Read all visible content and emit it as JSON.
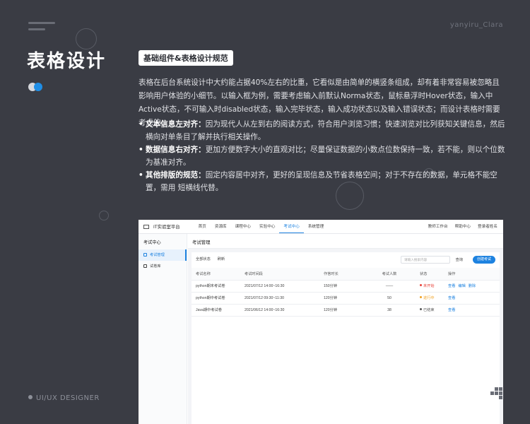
{
  "watermark": "yanyiru_Clara",
  "title": "表格设计",
  "tag": "基础组件&表格设计规范",
  "paragraph": "表格在后台系统设计中大约能占据40%左右的比重，它看似是由简单的横竖条组成，却有着非常容易被忽略且影响用户体验的小细节。以输入框为例，需要考虑输入前默认Norma状态，鼠标悬浮时Hover状态，输入中Active状态，不可输入时disabled状态，输入完毕状态，输入成功状态以及输入错误状态；而设计表格时需要考虑的：",
  "bullets": [
    {
      "title": "文本信息左对齐：",
      "text": "因为现代人从左到右的阅读方式，符合用户浏览习惯；快速浏览对比列获知关键信息，然后横向对单条目了解并执行相关操作。"
    },
    {
      "title": "数据信息右对齐：",
      "text": "更加方便数字大小的直观对比；尽量保证数据的小数点位数保持一致，若不能，则以个位数为基准对齐。"
    },
    {
      "title": "其他排版的规范：",
      "text": "固定内容居中对齐，更好的呈现信息及节省表格空间；对于不存在的数据，单元格不能空置，需用 短横线代替。"
    }
  ],
  "designer": "UI/UX DESIGNER",
  "screenshot": {
    "app_name": "IT实验室平台",
    "nav": [
      "首页",
      "资源库",
      "课程中心",
      "实验中心",
      "考试中心",
      "系统管理"
    ],
    "nav_active": "考试中心",
    "right": [
      "教师工作台",
      "帮助中心",
      "登录者姓名"
    ],
    "side_head": "考试中心",
    "side_items": [
      "考试管理",
      "试卷库"
    ],
    "page_title": "考试管理",
    "filter": "全部状态",
    "refresh": "刷新",
    "search_placeholder": "请输入搜索内容",
    "query": "查询",
    "create": "创建考试",
    "columns": [
      "考试名称",
      "考试时间段",
      "作答时长",
      "考试人数",
      "状态",
      "操作"
    ],
    "rows": [
      {
        "name": "python期末考试卷",
        "time": "2021/07/12 14:00~16:30",
        "dur": "150分钟",
        "count": "——",
        "status": "未开始",
        "status_color": "#e8433a",
        "ops": [
          "查看",
          "编辑",
          "删除"
        ]
      },
      {
        "name": "python期中考试卷",
        "time": "2021/07/12 09:30~11:30",
        "dur": "120分钟",
        "count": "50",
        "status": "进行中",
        "status_color": "#f0a020",
        "ops": [
          "查看"
        ]
      },
      {
        "name": "Java期中考试卷",
        "time": "2021/06/12 14:00~16:30",
        "dur": "120分钟",
        "count": "38",
        "status": "已结束",
        "status_color": "#555555",
        "ops": [
          "查看"
        ]
      }
    ]
  }
}
